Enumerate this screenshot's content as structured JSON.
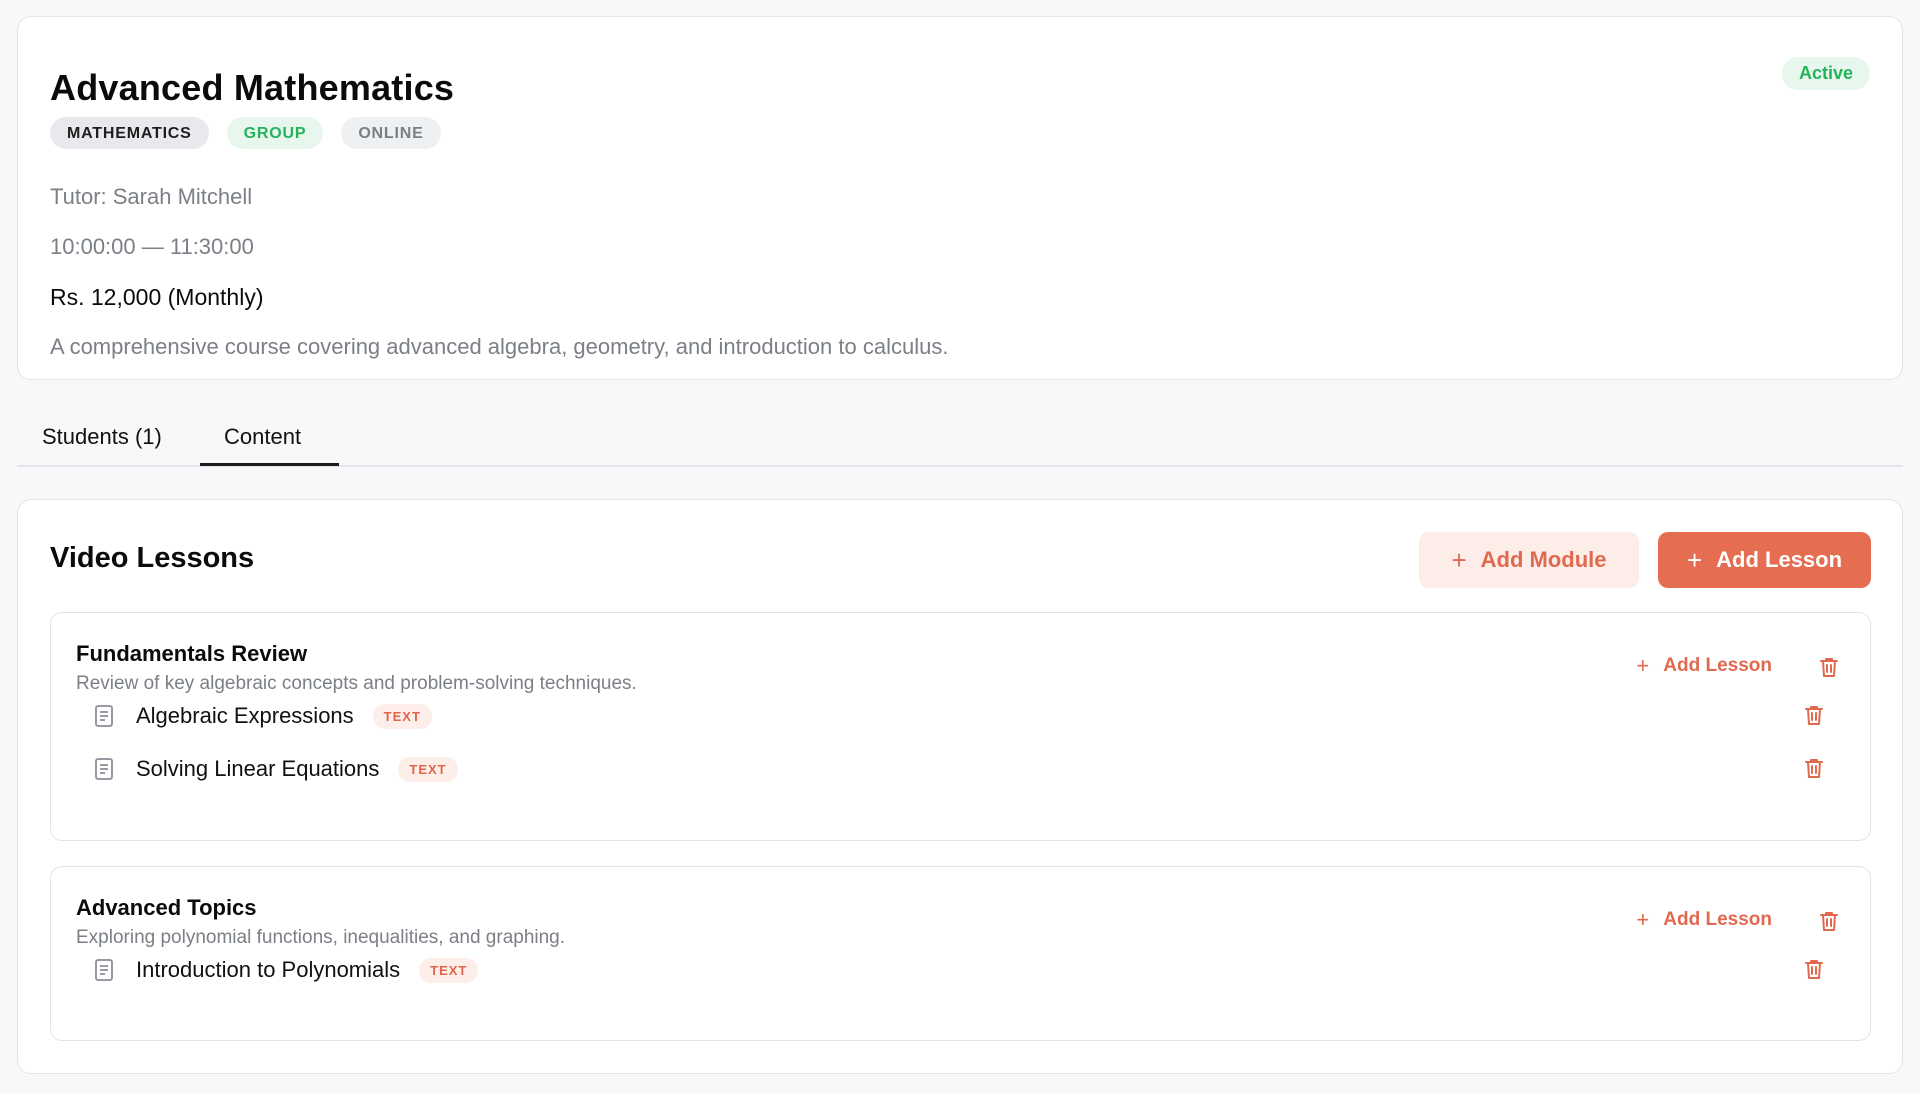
{
  "course": {
    "title": "Advanced Mathematics",
    "status": "Active",
    "tags": {
      "subject": "MATHEMATICS",
      "type": "GROUP",
      "mode": "ONLINE"
    },
    "tutor": "Tutor: Sarah Mitchell",
    "time": "10:00:00 — 11:30:00",
    "price": "Rs. 12,000 (Monthly)",
    "description": "A comprehensive course covering advanced algebra, geometry, and introduction to calculus."
  },
  "tabs": [
    {
      "label": "Students (1)"
    },
    {
      "label": "Content",
      "active": true
    }
  ],
  "content": {
    "title": "Video Lessons",
    "add_module_label": "Add Module",
    "add_lesson_label": "Add Lesson",
    "modules": [
      {
        "title": "Fundamentals Review",
        "description": "Review of key algebraic concepts and problem-solving techniques.",
        "add_lesson_label": "Add Lesson",
        "lessons": [
          {
            "title": "Algebraic Expressions",
            "type": "TEXT"
          },
          {
            "title": "Solving Linear Equations",
            "type": "TEXT"
          }
        ]
      },
      {
        "title": "Advanced Topics",
        "description": "Exploring polynomial functions, inequalities, and graphing.",
        "add_lesson_label": "Add Lesson",
        "lessons": [
          {
            "title": "Introduction to Polynomials",
            "type": "TEXT"
          }
        ]
      }
    ]
  },
  "icons": {
    "plus": "plus-icon",
    "trash": "trash-icon",
    "document": "document-icon"
  },
  "colors": {
    "accent": "#e46d52",
    "accent_light": "#fcede8",
    "success": "#22b45a",
    "muted_text": "#7b7f86"
  }
}
